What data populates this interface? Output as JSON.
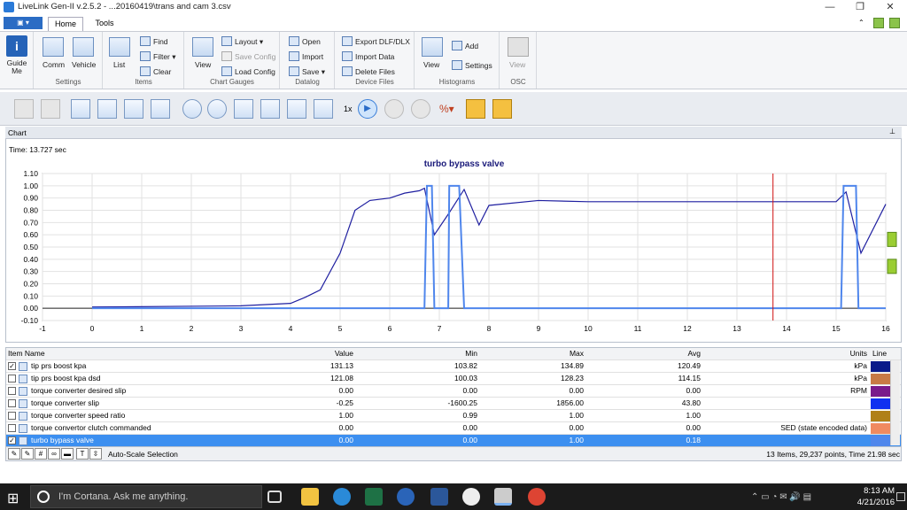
{
  "window": {
    "title": "LiveLink Gen-II  v.2.5.2 - ...20160419\\trans and cam 3.csv",
    "minimize": "—",
    "restore": "❐",
    "close": "✕"
  },
  "tabs": [
    {
      "label": "Home"
    },
    {
      "label": "Tools"
    }
  ],
  "ribbon": {
    "guide": {
      "label": "Guide Me"
    },
    "settings": {
      "label": "Settings",
      "comm": "Comm",
      "vehicle": "Vehicle"
    },
    "items": {
      "label": "Items",
      "list": "List",
      "find": "Find",
      "filter": "Filter ▾",
      "clear": "Clear"
    },
    "chartgauges": {
      "label": "Chart  Gauges",
      "view": "View",
      "layout": "Layout ▾",
      "saveconfig": "Save Config",
      "loadconfig": "Load Config"
    },
    "datalog": {
      "label": "Datalog",
      "open": "Open",
      "import": "Import",
      "save": "Save ▾"
    },
    "devicefiles": {
      "label": "Device Files",
      "export": "Export DLF/DLX",
      "importdata": "Import Data",
      "delete": "Delete Files"
    },
    "histograms": {
      "label": "Histograms",
      "view": "View",
      "add": "Add",
      "settings": "Settings"
    },
    "osc": {
      "label": "OSC",
      "view": "View"
    }
  },
  "toolbar": {
    "speed": "1x"
  },
  "chart": {
    "panel_title": "Chart",
    "time": "Time: 13.727 sec",
    "title": "turbo bypass valve"
  },
  "chart_data": {
    "type": "line",
    "title": "turbo bypass valve",
    "xlim": [
      -1,
      16
    ],
    "ylim": [
      -0.1,
      1.1
    ],
    "xticks": [
      -1,
      0,
      1,
      2,
      3,
      4,
      5,
      6,
      7,
      8,
      9,
      10,
      11,
      12,
      13,
      14,
      15,
      16
    ],
    "yticks": [
      "1.10",
      "1.00",
      "0.90",
      "0.80",
      "0.70",
      "0.60",
      "0.50",
      "0.40",
      "0.30",
      "0.20",
      "0.10",
      "0.00",
      "-0.10"
    ],
    "cursor_x": 13.727,
    "series": [
      {
        "color": "#1f1fa0",
        "x": [
          0,
          3,
          4,
          4.3,
          4.6,
          5,
          5.3,
          5.6,
          6,
          6.3,
          6.6,
          6.7,
          6.9,
          7.2,
          7.5,
          7.8,
          8,
          9,
          10,
          11,
          12,
          13,
          14,
          15,
          15.2,
          15.5,
          16
        ],
        "y": [
          0.01,
          0.02,
          0.04,
          0.09,
          0.15,
          0.45,
          0.8,
          0.88,
          0.9,
          0.94,
          0.96,
          0.98,
          0.6,
          0.78,
          0.97,
          0.68,
          0.84,
          0.88,
          0.87,
          0.87,
          0.87,
          0.87,
          0.87,
          0.87,
          0.95,
          0.45,
          0.85
        ]
      },
      {
        "color": "#4f86ec",
        "x": [
          0,
          6.7,
          6.75,
          6.85,
          6.9,
          7.18,
          7.2,
          7.4,
          7.5,
          15.1,
          15.15,
          15.4,
          15.45,
          16
        ],
        "y": [
          0,
          0,
          1,
          1,
          0,
          0,
          1,
          1,
          0,
          0,
          1,
          1,
          0,
          0
        ]
      }
    ]
  },
  "grid": {
    "headers": {
      "name": "Item Name",
      "value": "Value",
      "min": "Min",
      "max": "Max",
      "avg": "Avg",
      "units": "Units",
      "line": "Line"
    },
    "rows": [
      {
        "checked": "✓",
        "name": "tip prs boost kpa",
        "value": "131.13",
        "min": "103.82",
        "max": "134.89",
        "avg": "120.49",
        "units": "kPa",
        "color": "#0a1a8a"
      },
      {
        "checked": "",
        "name": "tip prs boost kpa dsd",
        "value": "121.08",
        "min": "100.03",
        "max": "128.23",
        "avg": "114.15",
        "units": "kPa",
        "color": "#c87a45"
      },
      {
        "checked": "",
        "name": "torque converter desired slip",
        "value": "0.00",
        "min": "0.00",
        "max": "0.00",
        "avg": "0.00",
        "units": "RPM",
        "color": "#7a1a8a"
      },
      {
        "checked": "",
        "name": "torque converter slip",
        "value": "-0.25",
        "min": "-1600.25",
        "max": "1856.00",
        "avg": "43.80",
        "units": "",
        "color": "#1030f0"
      },
      {
        "checked": "",
        "name": "torque converter speed ratio",
        "value": "1.00",
        "min": "0.99",
        "max": "1.00",
        "avg": "1.00",
        "units": "",
        "color": "#b08018"
      },
      {
        "checked": "",
        "name": "torque convertor clutch commanded",
        "value": "0.00",
        "min": "0.00",
        "max": "0.00",
        "avg": "0.00",
        "units": "SED (state encoded data)",
        "color": "#f08a60"
      },
      {
        "checked": "✓",
        "name": "turbo bypass valve",
        "value": "0.00",
        "min": "0.00",
        "max": "1.00",
        "avg": "0.18",
        "units": "",
        "color": "#4f86ec"
      }
    ],
    "autoscale": "Auto-Scale Selection",
    "status": "13 Items, 29,237 points, Time 21.98 sec"
  },
  "taskbar": {
    "search": "I'm Cortana. Ask me anything.",
    "time": "8:13 AM",
    "date": "4/21/2016"
  }
}
